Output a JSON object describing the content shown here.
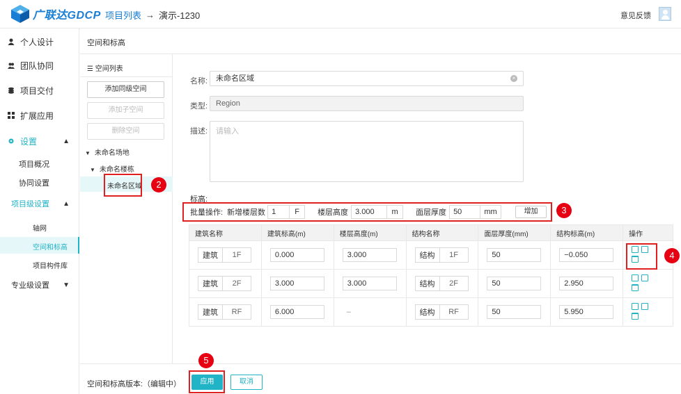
{
  "header": {
    "logo_text": "广联达",
    "logo_brand": "GDCP",
    "breadcrumb_link": "项目列表",
    "breadcrumb_current": "演示-1230",
    "feedback": "意见反馈"
  },
  "sidebar": {
    "personal": "个人设计",
    "team": "团队协同",
    "delivery": "项目交付",
    "extensions": "扩展应用",
    "settings": "设置",
    "project_overview": "项目概况",
    "collab_settings": "协同设置",
    "project_level_settings": "项目级设置",
    "axis_grid": "轴网",
    "space_elevation": "空间和标高",
    "component_library": "项目构件库",
    "discipline_settings": "专业级设置"
  },
  "page": {
    "title": "空间和标高"
  },
  "tree": {
    "heading": "空间列表",
    "add_sibling": "添加同级空间",
    "add_child": "添加子空间",
    "delete": "删除空间",
    "site": "未命名场地",
    "building": "未命名楼栋",
    "region": "未命名区域"
  },
  "form": {
    "name_label": "名称:",
    "name_value": "未命名区域",
    "type_label": "类型:",
    "type_value": "Region",
    "desc_label": "描述:",
    "desc_placeholder": "请输入",
    "elevation_label": "标高:",
    "batch_label": "批量操作:",
    "new_floors_label": "新增楼层数",
    "new_floors_value": "1",
    "new_floors_unit": "F",
    "floor_height_label": "楼层高度",
    "floor_height_value": "3.000",
    "floor_height_unit": "m",
    "surface_thickness_label": "面层厚度",
    "surface_thickness_value": "50",
    "surface_thickness_unit": "mm",
    "add_button": "增加"
  },
  "table": {
    "headers": [
      "建筑名称",
      "建筑标高(m)",
      "楼层高度(m)",
      "结构名称",
      "面层厚度(mm)",
      "结构标高(m)",
      "操作"
    ],
    "rows": [
      {
        "b_type": "建筑",
        "b_floor": "1F",
        "b_elev": "0.000",
        "height": "3.000",
        "s_type": "结构",
        "s_floor": "1F",
        "thickness": "50",
        "s_elev": "−0.050"
      },
      {
        "b_type": "建筑",
        "b_floor": "2F",
        "b_elev": "3.000",
        "height": "3.000",
        "s_type": "结构",
        "s_floor": "2F",
        "thickness": "50",
        "s_elev": "2.950"
      },
      {
        "b_type": "建筑",
        "b_floor": "RF",
        "b_elev": "6.000",
        "height": "–",
        "s_type": "结构",
        "s_floor": "RF",
        "thickness": "50",
        "s_elev": "5.950"
      }
    ]
  },
  "footer": {
    "version_label": "空间和标高版本:（编辑中）",
    "apply": "应用",
    "cancel": "取消"
  },
  "markers": [
    "2",
    "3",
    "4",
    "5"
  ],
  "colors": {
    "accent": "#21b3c6",
    "brand": "#1a7fd4",
    "marker": "#e60012"
  }
}
